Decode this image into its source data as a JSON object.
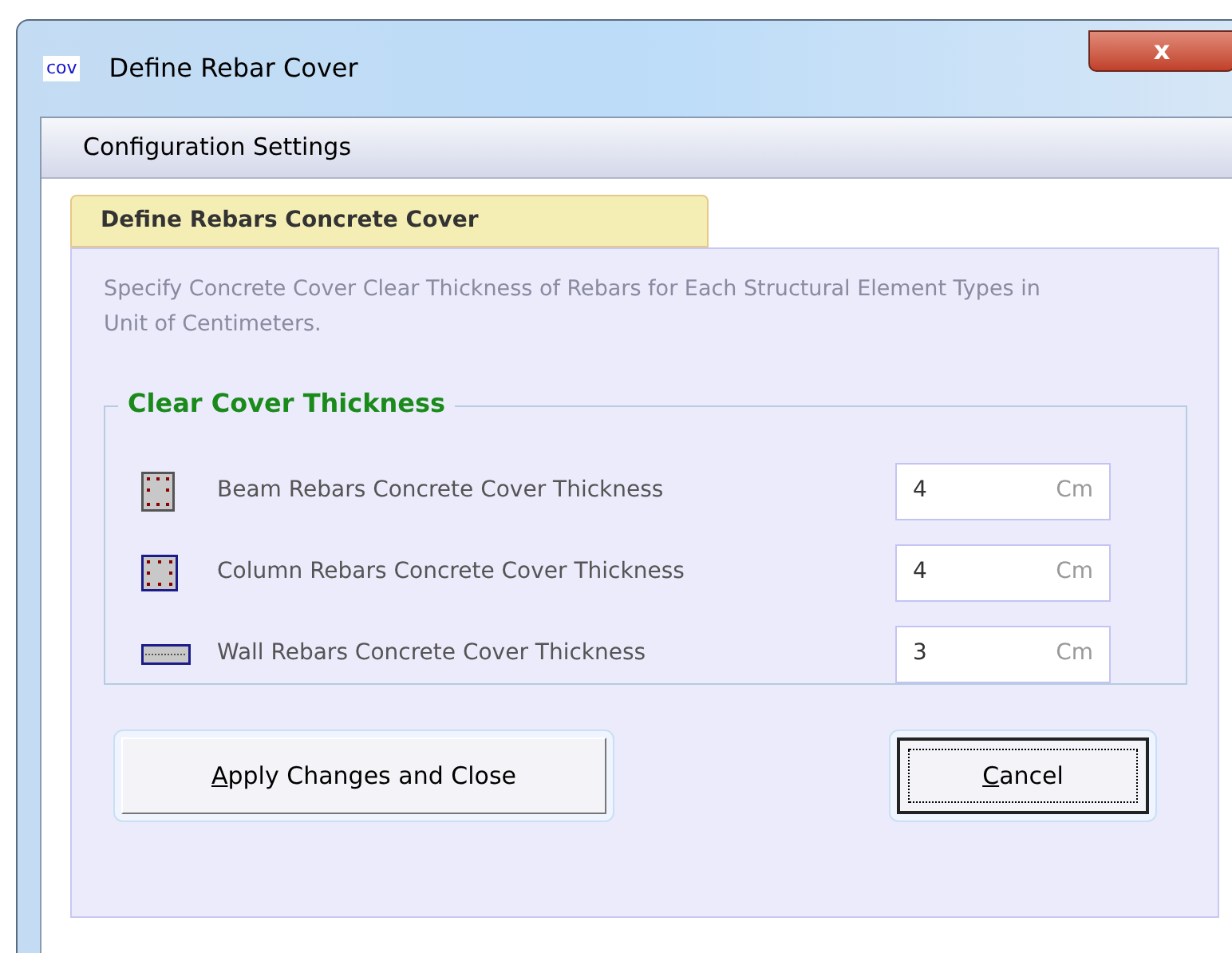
{
  "window": {
    "icon_text": "cov",
    "title": "Define Rebar Cover",
    "close": "x"
  },
  "header": "Configuration Settings",
  "tab": {
    "label": "Define Rebars Concrete Cover",
    "selected": true
  },
  "description": "Specify Concrete Cover Clear Thickness of Rebars for Each Structural Element Types in Unit of Centimeters.",
  "group": {
    "title": "Clear Cover Thickness",
    "rows": [
      {
        "kind": "beam",
        "label": "Beam Rebars Concrete Cover Thickness",
        "value": "4",
        "unit": "Cm"
      },
      {
        "kind": "column",
        "label": "Column Rebars Concrete Cover Thickness",
        "value": "4",
        "unit": "Cm"
      },
      {
        "kind": "wall",
        "label": "Wall Rebars Concrete Cover Thickness",
        "value": "3",
        "unit": "Cm"
      }
    ]
  },
  "buttons": [
    {
      "label": "Apply Changes and Close",
      "default": false
    },
    {
      "label": "Cancel",
      "default": true
    }
  ]
}
